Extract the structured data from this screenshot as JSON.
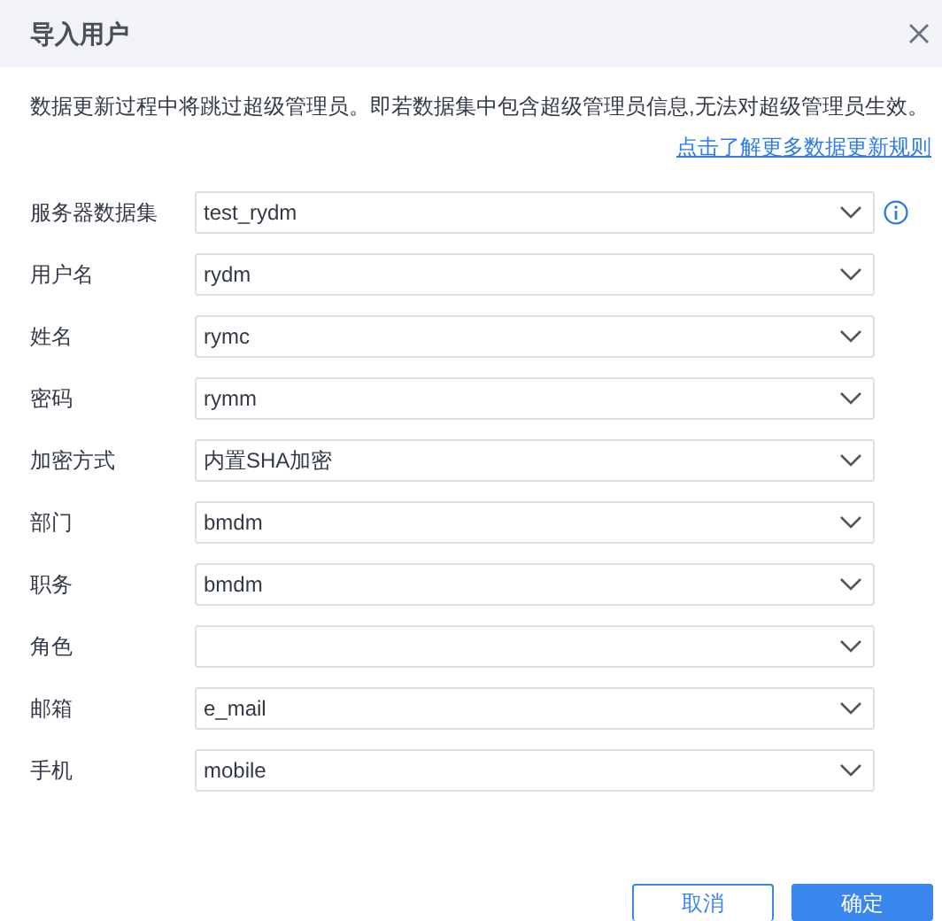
{
  "window": {
    "title": "导入用户"
  },
  "notice": "数据更新过程中将跳过超级管理员。即若数据集中包含超级管理员信息,无法对超级管理员生效。",
  "help_link": "点击了解更多数据更新规则",
  "fields": [
    {
      "label": "服务器数据集",
      "value": "test_rydm",
      "info": true
    },
    {
      "label": "用户名",
      "value": "rydm",
      "info": false
    },
    {
      "label": "姓名",
      "value": "rymc",
      "info": false
    },
    {
      "label": "密码",
      "value": "rymm",
      "info": false
    },
    {
      "label": "加密方式",
      "value": "内置SHA加密",
      "info": false
    },
    {
      "label": "部门",
      "value": "bmdm",
      "info": false
    },
    {
      "label": "职务",
      "value": "bmdm",
      "info": false
    },
    {
      "label": "角色",
      "info": false
    },
    {
      "label": "邮箱",
      "value": "e_mail",
      "info": false
    },
    {
      "label": "手机",
      "value": "mobile",
      "info": false
    }
  ],
  "buttons": [
    {
      "label": "取消",
      "kind": "secondary"
    },
    {
      "label": "确定",
      "kind": "primary"
    }
  ]
}
